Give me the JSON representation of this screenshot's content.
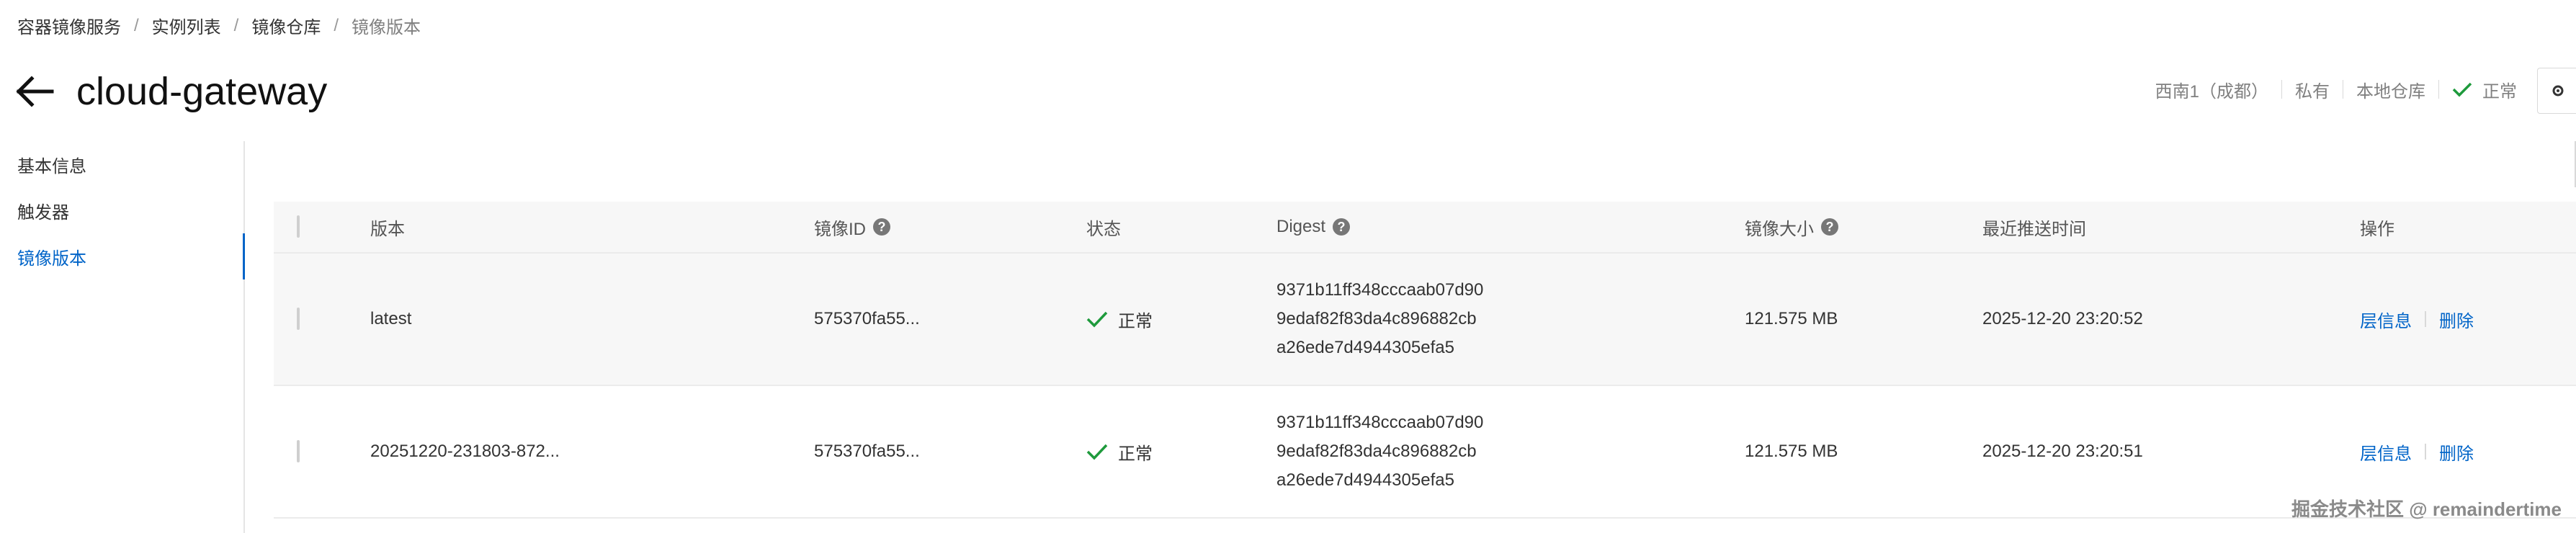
{
  "breadcrumb": {
    "items": [
      "容器镜像服务",
      "实例列表",
      "镜像仓库",
      "镜像版本"
    ],
    "separator": "/"
  },
  "header": {
    "title": "cloud-gateway",
    "status": {
      "region": "西南1（成都）",
      "visibility": "私有",
      "repo_type": "本地仓库",
      "state": "正常"
    }
  },
  "sidebar": {
    "items": [
      {
        "label": "基本信息",
        "active": false
      },
      {
        "label": "触发器",
        "active": false
      },
      {
        "label": "镜像版本",
        "active": true
      }
    ]
  },
  "table": {
    "columns": {
      "version": "版本",
      "image_id": "镜像ID",
      "status": "状态",
      "digest": "Digest",
      "size": "镜像大小",
      "pushed": "最近推送时间",
      "ops": "操作"
    },
    "rows": [
      {
        "version": "latest",
        "image_id": "575370fa55...",
        "status": "正常",
        "digest_lines": [
          "9371b11ff348cccaab07d90",
          "9edaf82f83da4c896882cb",
          "a26ede7d4944305efa5"
        ],
        "size": "121.575 MB",
        "pushed": "2025-12-20 23:20:52",
        "op_layer": "层信息",
        "op_delete": "删除"
      },
      {
        "version": "20251220-231803-872...",
        "image_id": "575370fa55...",
        "status": "正常",
        "digest_lines": [
          "9371b11ff348cccaab07d90",
          "9edaf82f83da4c896882cb",
          "a26ede7d4944305efa5"
        ],
        "size": "121.575 MB",
        "pushed": "2025-12-20 23:20:51",
        "op_layer": "层信息",
        "op_delete": "删除"
      }
    ]
  },
  "watermark": "掘金技术社区 @ remaindertime",
  "colors": {
    "accent": "#0064c8",
    "success": "#1e9a3c",
    "header_bg": "#f7f7f7"
  }
}
